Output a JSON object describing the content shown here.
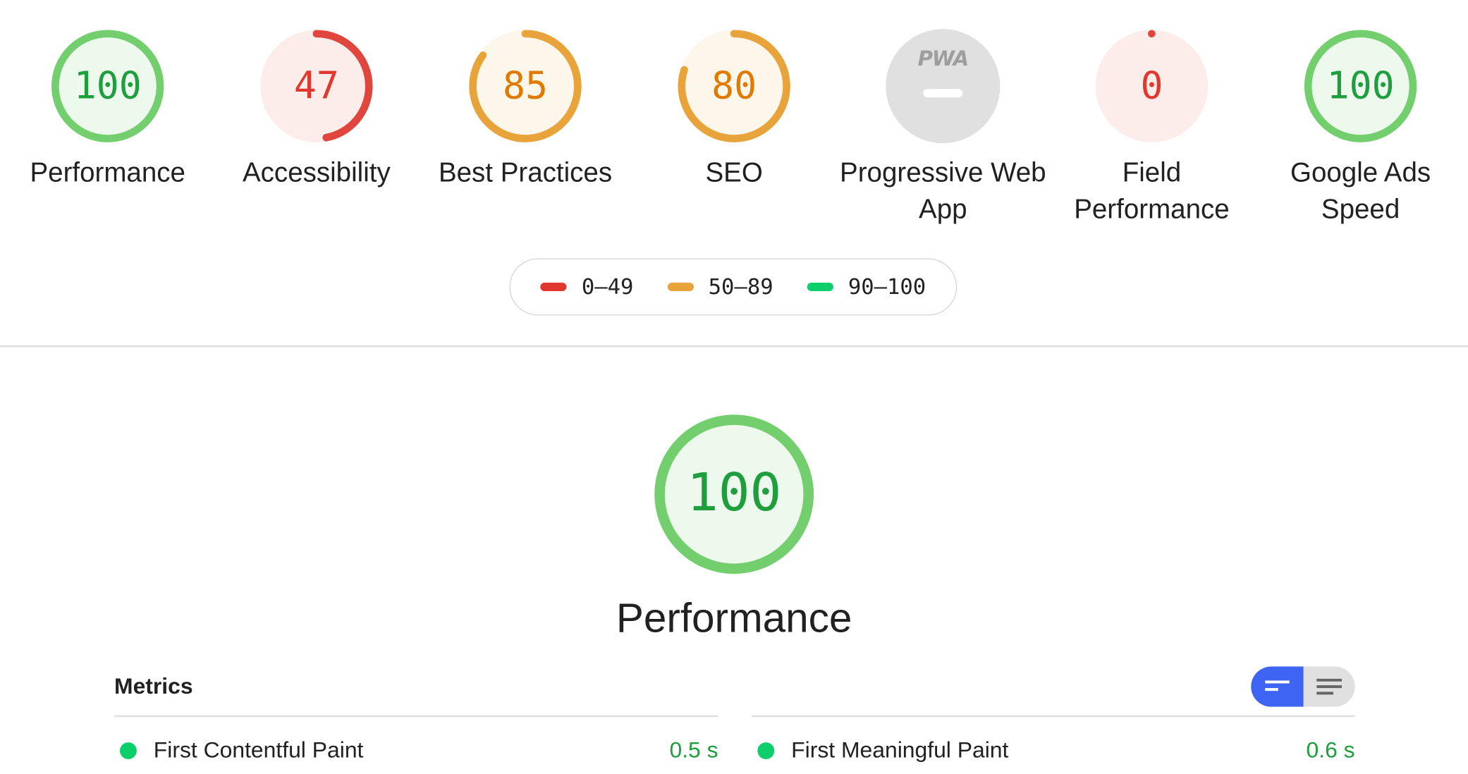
{
  "gauges": [
    {
      "id": "performance",
      "score": "100",
      "label": "Performance",
      "rating": "pass",
      "fraction": 1.0
    },
    {
      "id": "accessibility",
      "score": "47",
      "label": "Accessibility",
      "rating": "fail",
      "fraction": 0.47
    },
    {
      "id": "best-practices",
      "score": "85",
      "label": "Best Practices",
      "rating": "average",
      "fraction": 0.85
    },
    {
      "id": "seo",
      "score": "80",
      "label": "SEO",
      "rating": "average",
      "fraction": 0.8
    },
    {
      "id": "pwa",
      "badge_text": "PWA",
      "label": "Progressive Web App",
      "rating": "na"
    },
    {
      "id": "field-performance",
      "score": "0",
      "label": "Field Performance",
      "rating": "fail",
      "fraction": 0.0
    },
    {
      "id": "google-ads-speed",
      "score": "100",
      "label": "Google Ads Speed",
      "rating": "pass",
      "fraction": 1.0
    }
  ],
  "legend": [
    {
      "range": "0–49",
      "color": "#e0382f"
    },
    {
      "range": "50–89",
      "color": "#e8a43a"
    },
    {
      "range": "90–100",
      "color": "#0cce6b"
    }
  ],
  "colors": {
    "pass_ring": "#73cf6e",
    "pass_fill": "#eef9ee",
    "average_ring": "#e8a43a",
    "average_fill": "#fdf6ea",
    "fail_ring": "#e0463d",
    "fail_fill": "#fcecea",
    "toggle_active": "#3e64f4"
  },
  "section": {
    "score": "100",
    "title": "Performance",
    "fraction": 1.0
  },
  "metrics": {
    "header": "Metrics",
    "toggle": {
      "active": "compact-view-icon",
      "inactive": "expanded-view-icon"
    },
    "items": [
      {
        "name": "First Contentful Paint",
        "value": "0.5 s",
        "rating": "pass"
      },
      {
        "name": "First Meaningful Paint",
        "value": "0.6 s",
        "rating": "pass"
      }
    ]
  }
}
